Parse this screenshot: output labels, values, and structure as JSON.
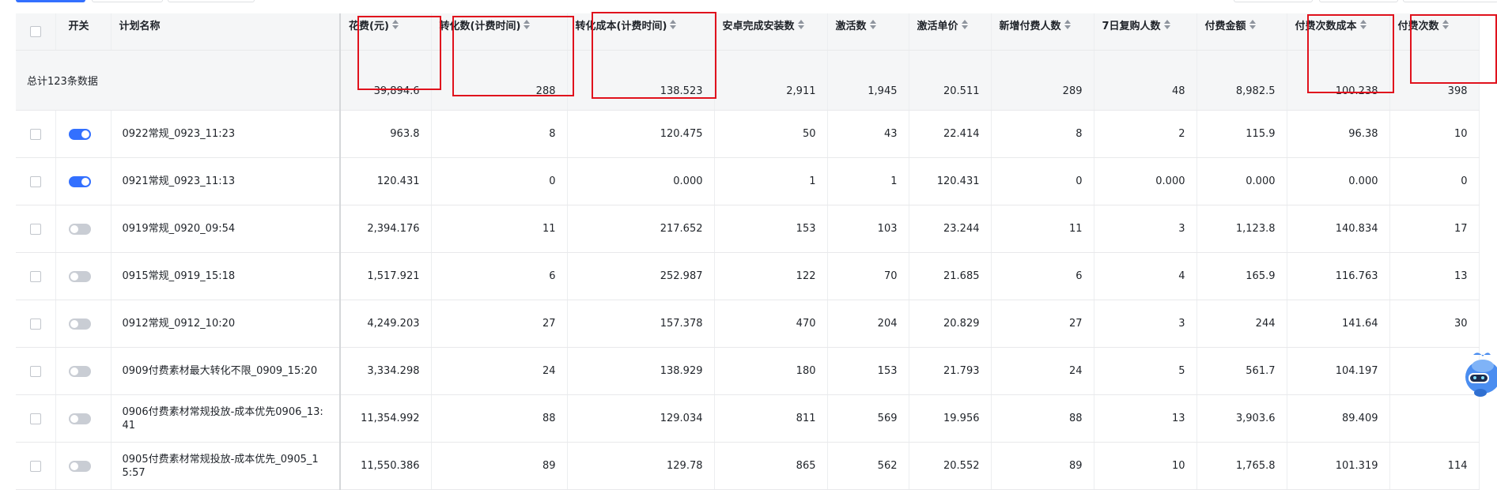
{
  "columns": [
    {
      "key": "select",
      "label": ""
    },
    {
      "key": "switch",
      "label": "开关"
    },
    {
      "key": "name",
      "label": "计划名称"
    },
    {
      "key": "cost",
      "label": "花费(元)"
    },
    {
      "key": "conversions",
      "label": "转化数(计费时间)"
    },
    {
      "key": "conversion_cost",
      "label": "转化成本(计费时间)"
    },
    {
      "key": "android_installs",
      "label": "安卓完成安装数"
    },
    {
      "key": "activations",
      "label": "激活数"
    },
    {
      "key": "activation_unit_price",
      "label": "激活单价"
    },
    {
      "key": "new_payers",
      "label": "新增付费人数"
    },
    {
      "key": "repurchase_7d",
      "label": "7日复购人数"
    },
    {
      "key": "pay_amount",
      "label": "付费金额"
    },
    {
      "key": "pay_count_cost",
      "label": "付费次数成本"
    },
    {
      "key": "pay_count",
      "label": "付费次数"
    }
  ],
  "total": {
    "label": "总计123条数据",
    "values": [
      "39,894.6",
      "288",
      "138.523",
      "2,911",
      "1,945",
      "20.511",
      "289",
      "48",
      "8,982.5",
      "100.238",
      "398"
    ]
  },
  "rows": [
    {
      "switch": "on",
      "name": "0922常规_0923_11:23",
      "values": [
        "963.8",
        "8",
        "120.475",
        "50",
        "43",
        "22.414",
        "8",
        "2",
        "115.9",
        "96.38",
        "10"
      ]
    },
    {
      "switch": "on",
      "name": "0921常规_0923_11:13",
      "values": [
        "120.431",
        "0",
        "0.000",
        "1",
        "1",
        "120.431",
        "0",
        "0.000",
        "0.000",
        "0.000",
        "0"
      ]
    },
    {
      "switch": "off",
      "name": "0919常规_0920_09:54",
      "values": [
        "2,394.176",
        "11",
        "217.652",
        "153",
        "103",
        "23.244",
        "11",
        "3",
        "1,123.8",
        "140.834",
        "17"
      ]
    },
    {
      "switch": "off",
      "name": "0915常规_0919_15:18",
      "values": [
        "1,517.921",
        "6",
        "252.987",
        "122",
        "70",
        "21.685",
        "6",
        "4",
        "165.9",
        "116.763",
        "13"
      ]
    },
    {
      "switch": "off",
      "name": "0912常规_0912_10:20",
      "values": [
        "4,249.203",
        "27",
        "157.378",
        "470",
        "204",
        "20.829",
        "27",
        "3",
        "244",
        "141.64",
        "30"
      ]
    },
    {
      "switch": "off",
      "name": "0909付费素材最大转化不限_0909_15:20",
      "values": [
        "3,334.298",
        "24",
        "138.929",
        "180",
        "153",
        "21.793",
        "24",
        "5",
        "561.7",
        "104.197",
        ""
      ]
    },
    {
      "switch": "off",
      "name": "0906付费素材常规投放-成本优先0906_13:41",
      "values": [
        "11,354.992",
        "88",
        "129.034",
        "811",
        "569",
        "19.956",
        "88",
        "13",
        "3,903.6",
        "89.409",
        ""
      ]
    },
    {
      "switch": "off",
      "name": "0905付费素材常规投放-成本优先_0905_15:57",
      "values": [
        "11,550.386",
        "89",
        "129.78",
        "865",
        "562",
        "20.552",
        "89",
        "10",
        "1,765.8",
        "101.319",
        "114"
      ]
    }
  ],
  "colors": {
    "accent": "#3370ff",
    "highlight_box": "#e0121d",
    "header_bg": "#f5f6f7"
  },
  "icons": [
    "sort-icon",
    "assistant-robot-icon"
  ]
}
